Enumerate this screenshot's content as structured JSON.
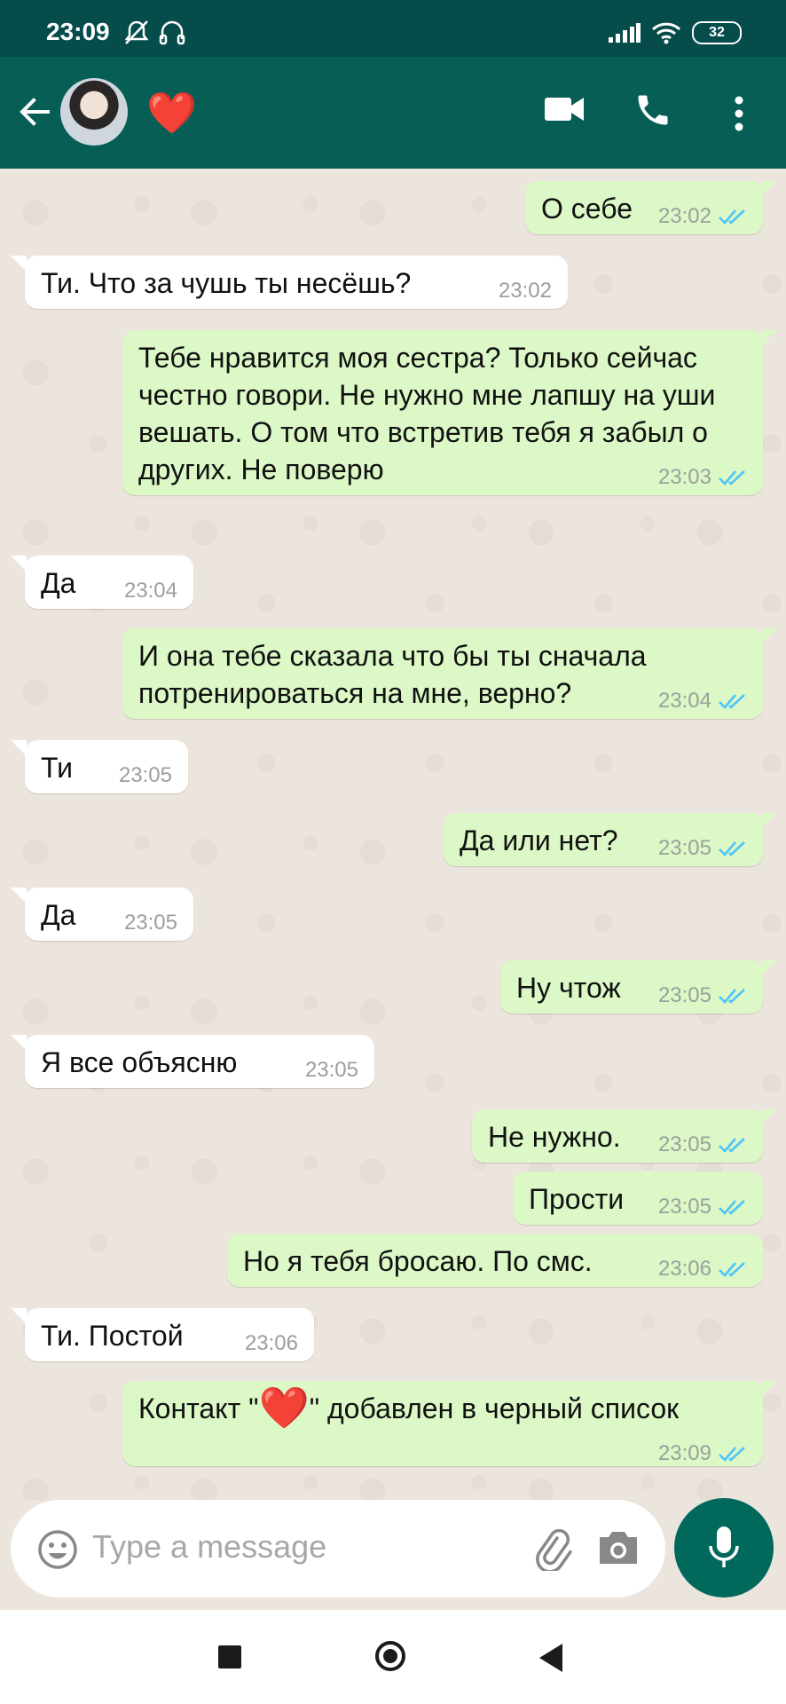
{
  "status_bar": {
    "time": "23:09",
    "battery": "32",
    "icons": [
      "mute-bell-icon",
      "headset-icon",
      "signal-icon",
      "wifi-icon",
      "battery-icon"
    ]
  },
  "header": {
    "contact_name": "❤️",
    "icons": [
      "back-arrow-icon",
      "video-call-icon",
      "phone-icon",
      "more-vert-icon"
    ]
  },
  "messages": [
    {
      "dir": "out",
      "text": "О себе",
      "time": "23:02"
    },
    {
      "dir": "in",
      "text": "Ти. Что за чушь ты несёшь?",
      "time": "23:02"
    },
    {
      "dir": "out",
      "text": "Тебе нравится моя сестра? Только сейчас честно говори. Не нужно мне лапшу на уши вешать. О том что встретив тебя я забыл о других. Не поверю",
      "time": "23:03"
    },
    {
      "dir": "in",
      "text": "Да",
      "time": "23:04"
    },
    {
      "dir": "out",
      "text": "И она тебе сказала что бы ты сначала потренироваться на мне, верно?",
      "time": "23:04"
    },
    {
      "dir": "in",
      "text": "Ти",
      "time": "23:05"
    },
    {
      "dir": "out",
      "text": "Да или нет?",
      "time": "23:05"
    },
    {
      "dir": "in",
      "text": "Да",
      "time": "23:05"
    },
    {
      "dir": "out",
      "text": "Ну чтож",
      "time": "23:05"
    },
    {
      "dir": "in",
      "text": "Я все объясню",
      "time": "23:05"
    },
    {
      "dir": "out",
      "text": "Не нужно.",
      "time": "23:05"
    },
    {
      "dir": "out",
      "text": "Прости",
      "time": "23:05"
    },
    {
      "dir": "out",
      "text": "Но я тебя бросаю. По смс.",
      "time": "23:06"
    },
    {
      "dir": "in",
      "text": "Ти. Постой",
      "time": "23:06"
    },
    {
      "dir": "out",
      "text_before": "Контакт \"",
      "text_emoji": "❤️",
      "text_after": "\" добавлен в черный список",
      "time": "23:09"
    }
  ],
  "composer": {
    "placeholder": "Type a message",
    "icons": [
      "emoji-icon",
      "attach-icon",
      "camera-icon",
      "mic-icon"
    ]
  },
  "colors": {
    "header": "#075e54",
    "status_bar": "#054c4a",
    "outgoing_bubble": "#dcf8c6",
    "incoming_bubble": "#ffffff",
    "read_ticks": "#4fc3f7",
    "chat_bg": "#ece5dd"
  }
}
